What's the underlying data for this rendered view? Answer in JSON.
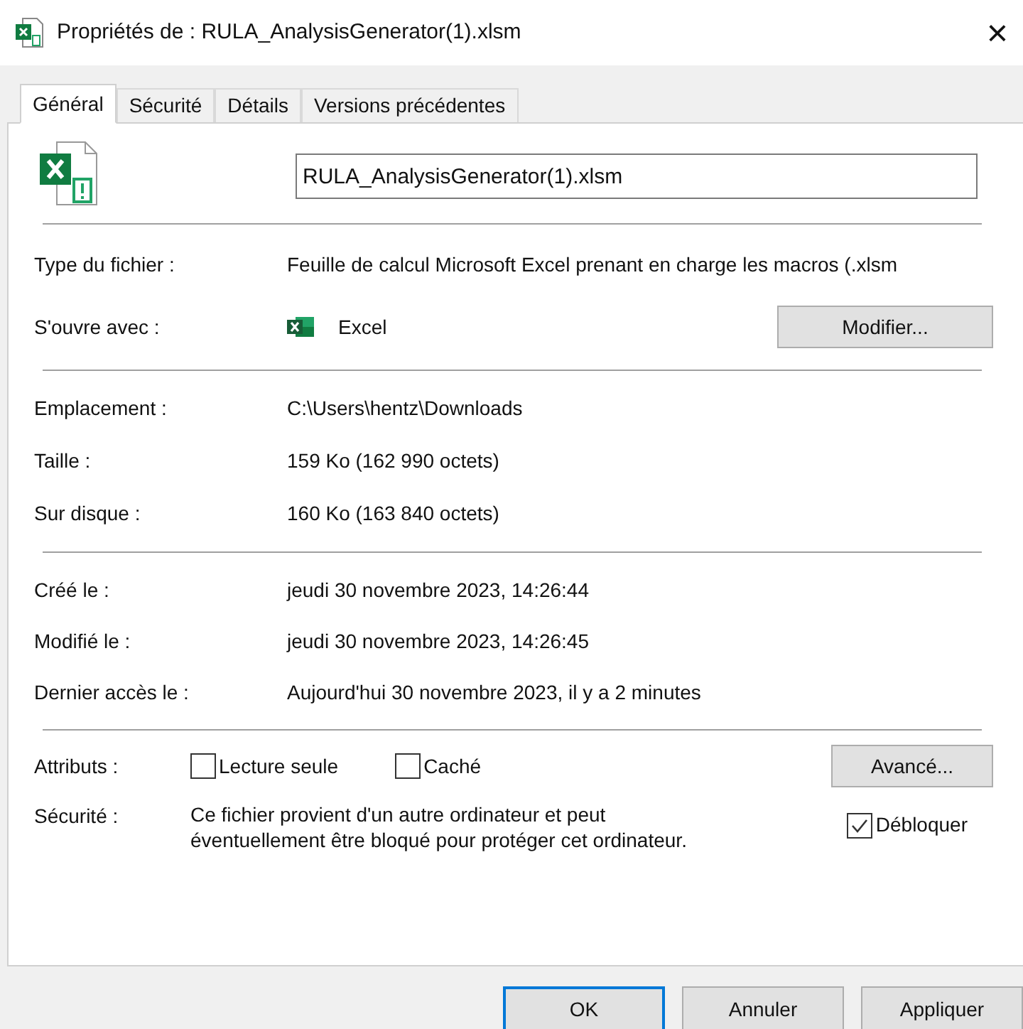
{
  "window": {
    "title": "Propriétés de : RULA_AnalysisGenerator(1).xlsm",
    "close": "×"
  },
  "tabs": [
    {
      "label": "Général",
      "selected": true
    },
    {
      "label": "Sécurité",
      "selected": false
    },
    {
      "label": "Détails",
      "selected": false
    },
    {
      "label": "Versions précédentes",
      "selected": false
    }
  ],
  "file_name": {
    "value": "RULA_AnalysisGenerator(1).xlsm"
  },
  "type_section": [
    {
      "label": "Type du fichier :",
      "value": "Feuille de calcul Microsoft Excel prenant en charge les macros (.xlsm"
    },
    {
      "label": "S'ouvre avec :",
      "value": "Excel",
      "button": "Modifier..."
    }
  ],
  "location_section": [
    {
      "label": "Emplacement :",
      "value": "C:\\Users\\hentz\\Downloads"
    },
    {
      "label": "Taille :",
      "value": "159 Ko (162 990 octets)"
    },
    {
      "label": "Sur disque :",
      "value": "160 Ko (163 840 octets)"
    }
  ],
  "dates_section": [
    {
      "label": "Créé le :",
      "value": "jeudi 30 novembre 2023, 14:26:44"
    },
    {
      "label": "Modifié le :",
      "value": "jeudi 30 novembre 2023, 14:26:45"
    },
    {
      "label": "Dernier accès le :",
      "value": "Aujourd'hui 30 novembre 2023, il y a 2 minutes"
    }
  ],
  "attributes": {
    "label": "Attributs :",
    "checkboxes": [
      {
        "label": "Lecture seule",
        "checked": false
      },
      {
        "label": "Caché",
        "checked": false
      }
    ],
    "button": "Avancé..."
  },
  "security": {
    "label": "Sécurité :",
    "text": "Ce fichier provient d'un autre ordinateur et peut\néventuellement être bloqué pour protéger cet ordinateur.",
    "checkbox": {
      "label": "Débloquer",
      "checked": true
    }
  },
  "buttons": [
    {
      "label": "OK",
      "selected": true
    },
    {
      "label": "Annuler",
      "selected": false
    },
    {
      "label": "Appliquer",
      "selected": false
    }
  ]
}
